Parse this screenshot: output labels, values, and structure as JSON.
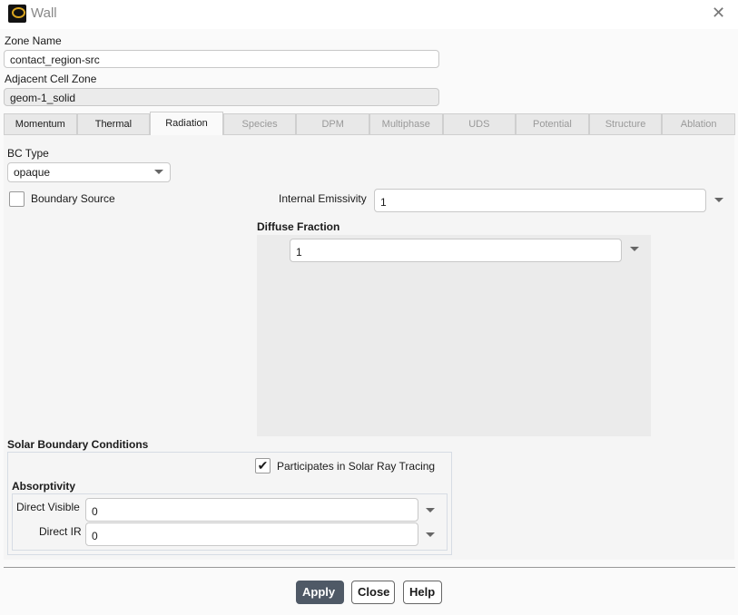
{
  "window": {
    "title": "Wall"
  },
  "zone_name": {
    "label": "Zone Name",
    "value": "contact_region-src"
  },
  "adjacent": {
    "label": "Adjacent Cell Zone",
    "value": "geom-1_solid"
  },
  "tabs": [
    {
      "label": "Momentum"
    },
    {
      "label": "Thermal"
    },
    {
      "label": "Radiation"
    },
    {
      "label": "Species"
    },
    {
      "label": "DPM"
    },
    {
      "label": "Multiphase"
    },
    {
      "label": "UDS"
    },
    {
      "label": "Potential"
    },
    {
      "label": "Structure"
    },
    {
      "label": "Ablation"
    }
  ],
  "radiation": {
    "bc_type_label": "BC Type",
    "bc_type": "opaque",
    "boundary_source": "Boundary Source",
    "emissivity_label": "Internal Emissivity",
    "emissivity": "1",
    "diffuse_label": "Diffuse Fraction",
    "diffuse": "1"
  },
  "solar": {
    "title": "Solar Boundary Conditions",
    "participates": "Participates in Solar Ray Tracing",
    "absorptivity": "Absorptivity",
    "direct_visible_label": "Direct Visible",
    "direct_visible": "0",
    "direct_ir_label": "Direct IR",
    "direct_ir": "0"
  },
  "buttons": {
    "apply": "Apply",
    "close": "Close",
    "help": "Help"
  }
}
